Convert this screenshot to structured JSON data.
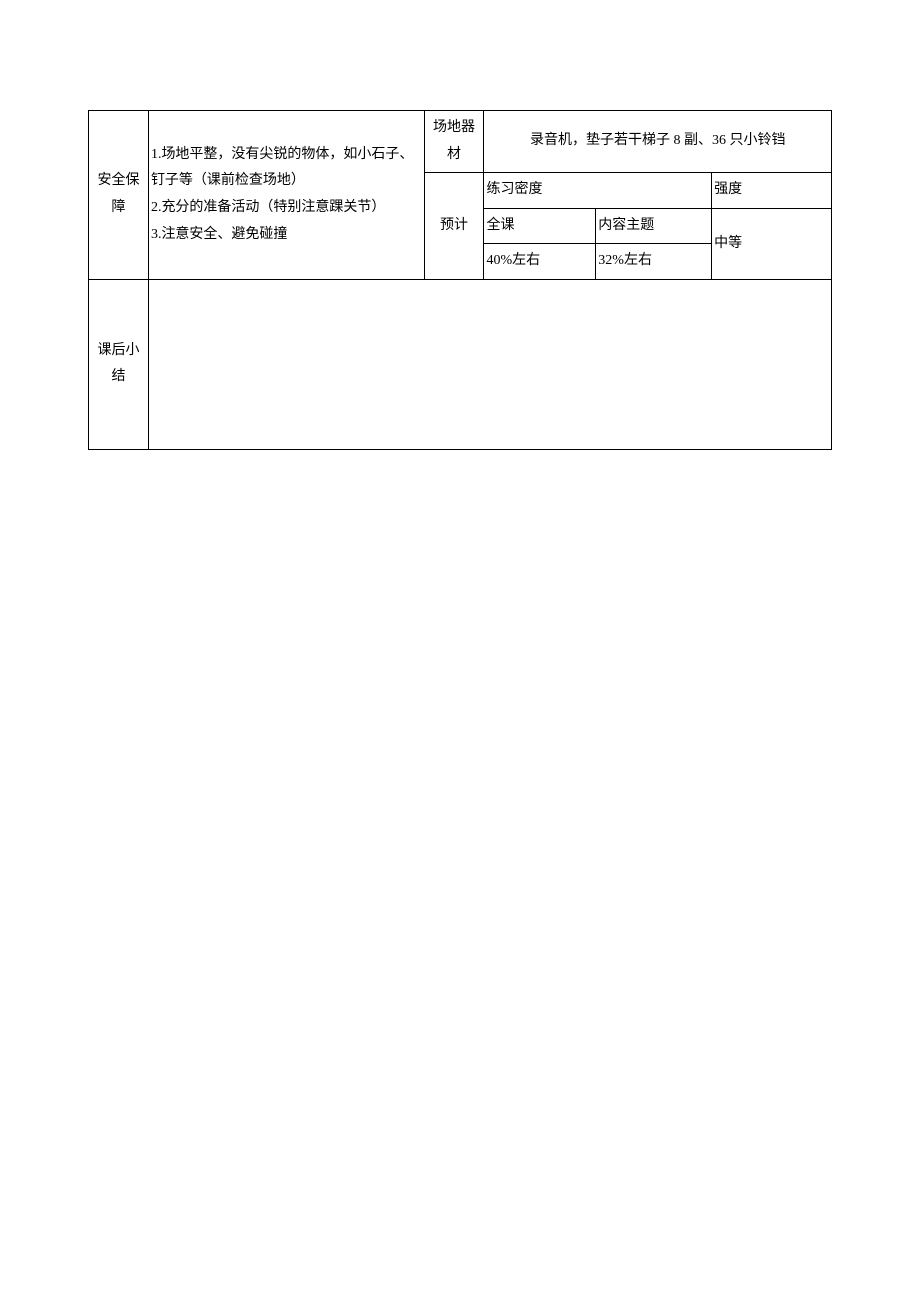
{
  "labels": {
    "safety": "安全保障",
    "venue_equipment": "场地器材",
    "estimate": "预计",
    "practice_density": "练习密度",
    "intensity": "强度",
    "whole_class": "全课",
    "content_topic": "内容主题",
    "post_class_summary": "课后小结"
  },
  "safety_items": {
    "item1": "1.场地平整，没有尖锐的物体，如小石子、钉子等（课前检查场地）",
    "item2": "2.充分的准备活动（特别注意踝关节）",
    "item3": "3.注意安全、避免碰撞"
  },
  "values": {
    "venue_equipment": "录音机，垫子若干梯子 8 副、36 只小铃铛",
    "whole_class_value": "40%左右",
    "content_topic_value": "32%左右",
    "intensity_value": "中等",
    "post_class_summary_content": ""
  }
}
